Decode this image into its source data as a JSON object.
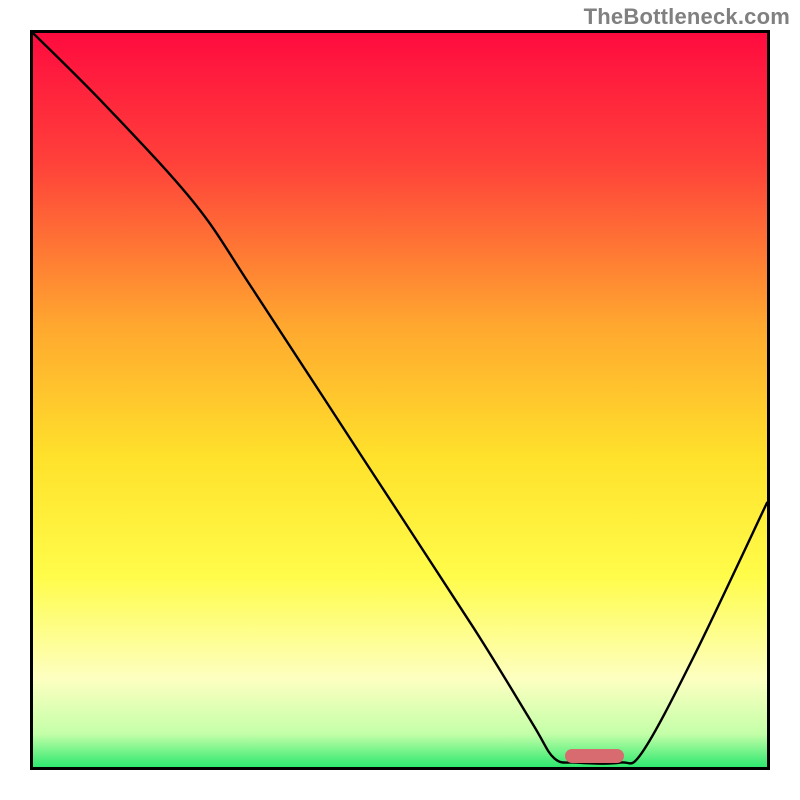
{
  "watermark": "TheBottleneck.com",
  "chart_data": {
    "type": "line",
    "title": "",
    "xlabel": "",
    "ylabel": "",
    "xlim": [
      0,
      100
    ],
    "ylim": [
      0,
      100
    ],
    "background": {
      "gradient_stops": [
        {
          "offset": 0.0,
          "color": "#ff0b3f"
        },
        {
          "offset": 0.18,
          "color": "#ff423a"
        },
        {
          "offset": 0.4,
          "color": "#ffa82f"
        },
        {
          "offset": 0.58,
          "color": "#ffe22b"
        },
        {
          "offset": 0.74,
          "color": "#fffc4a"
        },
        {
          "offset": 0.88,
          "color": "#fdffc1"
        },
        {
          "offset": 0.955,
          "color": "#c4ffa8"
        },
        {
          "offset": 1.0,
          "color": "#2ee86f"
        }
      ]
    },
    "curve": {
      "stroke": "#000000",
      "stroke_width": 2.4,
      "points": [
        {
          "x": 0.0,
          "y": 100.0
        },
        {
          "x": 10.0,
          "y": 90.0
        },
        {
          "x": 22.0,
          "y": 76.8
        },
        {
          "x": 30.0,
          "y": 65.0
        },
        {
          "x": 45.0,
          "y": 42.0
        },
        {
          "x": 60.0,
          "y": 19.0
        },
        {
          "x": 68.0,
          "y": 6.0
        },
        {
          "x": 71.0,
          "y": 1.2
        },
        {
          "x": 74.0,
          "y": 0.6
        },
        {
          "x": 80.0,
          "y": 0.6
        },
        {
          "x": 83.0,
          "y": 2.0
        },
        {
          "x": 90.0,
          "y": 15.0
        },
        {
          "x": 100.0,
          "y": 36.0
        }
      ]
    },
    "marker": {
      "color": "#d86b70",
      "x_start": 72.5,
      "x_end": 80.5,
      "y": 1.5,
      "height": 2.0,
      "border_radius": 8
    }
  }
}
